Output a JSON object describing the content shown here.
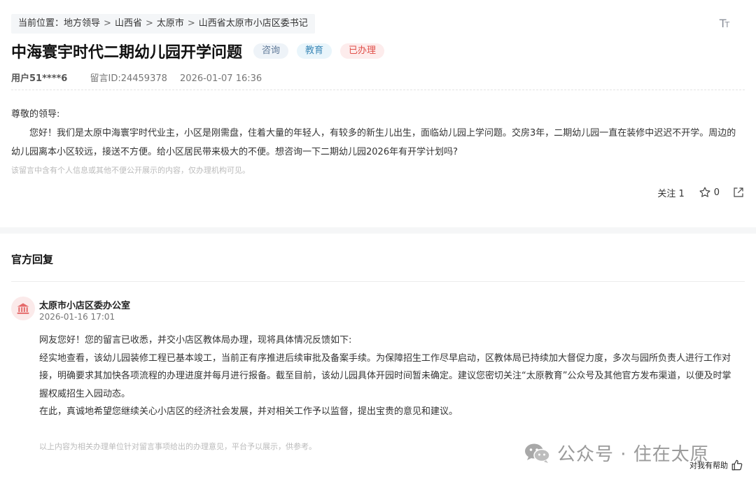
{
  "breadcrumb": {
    "prefix": "当前位置：",
    "items": [
      "地方领导",
      "山西省",
      "太原市",
      "山西省太原市小店区委书记"
    ]
  },
  "font_toggle": {
    "big": "T",
    "small": "T"
  },
  "message": {
    "title": "中海寰宇时代二期幼儿园开学问题",
    "tags": {
      "type": "咨询",
      "category": "教育",
      "status": "已办理"
    },
    "user": "用户51****6",
    "id": "留言ID:24459378",
    "datetime": "2026-01-07 16:36",
    "salutation": "尊敬的领导:",
    "body": "您好！我们是太原中海寰宇时代业主，小区是刚需盘，住着大量的年轻人，有较多的新生儿出生，面临幼儿园上学问题。交房3年，二期幼儿园一直在装修中迟迟不开学。周边的幼儿园离本小区较远，接送不方便。给小区居民带来极大的不便。想咨询一下二期幼儿园2026年有开学计划吗?",
    "privacy_note": "该留言中含有个人信息或其他不便公开展示的内容，仅办理机构可见。"
  },
  "actions": {
    "follow_label": "关注 1",
    "star_count": "0"
  },
  "reply": {
    "section_title": "官方回复",
    "org_name": "太原市小店区委办公室",
    "date": "2026-01-16 17:01",
    "paragraphs": [
      "网友您好！您的留言已收悉，并交小店区教体局办理，现将具体情况反馈如下:",
      "经实地查看，该幼儿园装修工程已基本竣工，当前正有序推进后续审批及备案手续。为保障招生工作尽早启动，区教体局已持续加大督促力度，多次与园所负责人进行工作对接，明确要求其加快各项流程的办理进度并每月进行报备。截至目前，该幼儿园具体开园时间暂未确定。建议您密切关注“太原教育”公众号及其他官方发布渠道，以便及时掌握权威招生入园动态。",
      "在此，真诚地希望您继续关心小店区的经济社会发展，并对相关工作予以监督，提出宝贵的意见和建议。"
    ],
    "disclaimer": "以上内容为相关办理单位针对留言事项给出的办理意见，平台予以展示，供参考。",
    "helpful_label": "对我有帮助"
  },
  "watermark": {
    "text": "公众号 · 住在太原"
  },
  "colors": {
    "status_red": "#e0504a",
    "category_blue": "#3d89b8",
    "type_gray": "#5e7897"
  },
  "icons": {
    "font": "font-size-icon",
    "star": "star-icon",
    "share": "share-icon",
    "org": "government-building-icon",
    "wechat": "wechat-icon",
    "thumb": "thumbs-up-icon"
  }
}
